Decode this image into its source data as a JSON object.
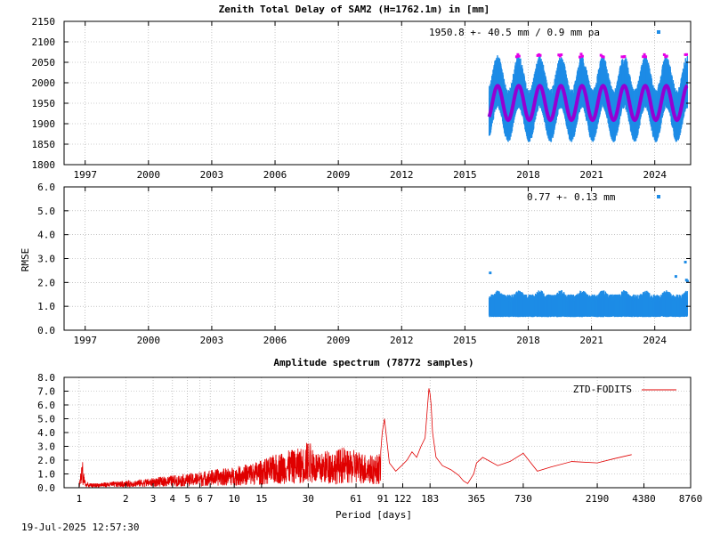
{
  "colors": {
    "series_blue": "#1e8ce6",
    "series_purple": "#9400d3",
    "series_magenta": "#e600e6",
    "series_red": "#e00000"
  },
  "footer": {
    "timestamp": "19-Jul-2025 12:57:30"
  },
  "chart_data": [
    {
      "type": "scatter",
      "title": "Zenith Total Delay of SAM2 (H=1762.1m) in [mm]",
      "xlabel": "",
      "ylabel": "",
      "annotation": "1950.8 +-  40.5 mm /  0.9 mm pa",
      "xlim": [
        1996.0,
        2025.7
      ],
      "ylim": [
        1800,
        2150
      ],
      "x_ticks": [
        1997,
        2000,
        2003,
        2006,
        2009,
        2012,
        2015,
        2018,
        2021,
        2024
      ],
      "x_tick_labels": [
        "1997",
        "2000",
        "2003",
        "2006",
        "2009",
        "2012",
        "2015",
        "2018",
        "2021",
        "2024"
      ],
      "y_ticks": [
        1800,
        1850,
        1900,
        1950,
        2000,
        2050,
        2100,
        2150
      ],
      "y_tick_labels": [
        "1800",
        "1850",
        "1900",
        "1950",
        "2000",
        "2050",
        "2100",
        "2150"
      ],
      "grid": true,
      "legend": "none",
      "series": [
        {
          "kind": "daily_range_observations",
          "x_start": 2016.15,
          "x_end": 2025.55,
          "mean": 1950.8,
          "seasonal_amplitude": 42,
          "spread_low": 55,
          "spread_high": 75,
          "abs_min": 1850,
          "abs_max": 2070
        },
        {
          "kind": "seasonal_fit",
          "x_start": 2016.15,
          "x_end": 2025.55,
          "mean": 1950.8,
          "amplitude": 42,
          "trend_mm_per_year": 0.9
        }
      ]
    },
    {
      "type": "scatter",
      "title": "",
      "xlabel": "",
      "ylabel": "RMSE",
      "annotation": "0.77 +-  0.13 mm",
      "xlim": [
        1996.0,
        2025.7
      ],
      "ylim": [
        0.0,
        6.0
      ],
      "x_ticks": [
        1997,
        2000,
        2003,
        2006,
        2009,
        2012,
        2015,
        2018,
        2021,
        2024
      ],
      "x_tick_labels": [
        "1997",
        "2000",
        "2003",
        "2006",
        "2009",
        "2012",
        "2015",
        "2018",
        "2021",
        "2024"
      ],
      "y_ticks": [
        0.0,
        1.0,
        2.0,
        3.0,
        4.0,
        5.0,
        6.0
      ],
      "y_tick_labels": [
        "0.0",
        "1.0",
        "2.0",
        "3.0",
        "4.0",
        "5.0",
        "6.0"
      ],
      "grid": true,
      "legend": "none",
      "series": [
        {
          "kind": "rmse_observations",
          "x_start": 2016.15,
          "x_end": 2025.55,
          "base": 0.85,
          "range_low": 0.55,
          "range_high": 1.35,
          "outliers": [
            {
              "x": 2016.2,
              "y": 2.4
            },
            {
              "x": 2025.0,
              "y": 2.25
            },
            {
              "x": 2025.45,
              "y": 2.85
            },
            {
              "x": 2025.5,
              "y": 2.1
            },
            {
              "x": 2025.55,
              "y": 2.05
            }
          ]
        }
      ]
    },
    {
      "type": "line",
      "title": "Amplitude spectrum (78772 samples)",
      "xlabel": "Period [days]",
      "ylabel": "",
      "scale": "log-x",
      "xlim": [
        0.8,
        8760
      ],
      "ylim": [
        0.0,
        8.0
      ],
      "x_ticks": [
        1,
        2,
        3,
        4,
        5,
        6,
        7,
        10,
        15,
        30,
        61,
        91,
        122,
        183,
        365,
        730,
        2190,
        4380,
        8760
      ],
      "x_tick_labels": [
        "1",
        "2",
        "3",
        "4",
        "5",
        "6",
        "7",
        "10",
        "15",
        "30",
        "61",
        "91",
        "122",
        "183",
        "365",
        "730",
        "2190",
        "4380",
        "8760"
      ],
      "y_ticks": [
        0.0,
        1.0,
        2.0,
        3.0,
        4.0,
        5.0,
        6.0,
        7.0,
        8.0
      ],
      "y_tick_labels": [
        "0.0",
        "1.0",
        "2.0",
        "3.0",
        "4.0",
        "5.0",
        "6.0",
        "7.0",
        "8.0"
      ],
      "grid": true,
      "legend": "top-right",
      "series": [
        {
          "name": "ZTD-FODITS",
          "kind": "amplitude_spectrum",
          "x": [
            1.0,
            1.05,
            1.1,
            1.2,
            1.5,
            2,
            3,
            4,
            5,
            7,
            10,
            15,
            20,
            25,
            28,
            30,
            35,
            40,
            45,
            50,
            55,
            60,
            70,
            80,
            88,
            90,
            93,
            100,
            110,
            120,
            130,
            140,
            150,
            160,
            170,
            176,
            180,
            183,
            186,
            190,
            200,
            220,
            250,
            280,
            300,
            320,
            350,
            365,
            400,
            500,
            600,
            730,
            900,
            1100,
            1500,
            2190,
            2800,
            3650
          ],
          "values": [
            0.3,
            2.1,
            0.4,
            0.3,
            0.4,
            0.5,
            0.7,
            0.9,
            1.0,
            1.3,
            1.5,
            2.0,
            2.6,
            2.8,
            3.0,
            3.5,
            2.4,
            2.8,
            2.7,
            3.0,
            2.6,
            2.8,
            2.5,
            2.3,
            2.6,
            4.0,
            5.0,
            1.8,
            1.2,
            1.6,
            2.0,
            2.6,
            2.2,
            3.0,
            3.6,
            5.8,
            7.2,
            6.8,
            6.0,
            4.0,
            2.2,
            1.6,
            1.3,
            0.9,
            0.5,
            0.3,
            1.0,
            1.8,
            2.2,
            1.6,
            1.9,
            2.5,
            1.2,
            1.5,
            1.9,
            1.8,
            2.1,
            2.4
          ]
        }
      ]
    }
  ]
}
